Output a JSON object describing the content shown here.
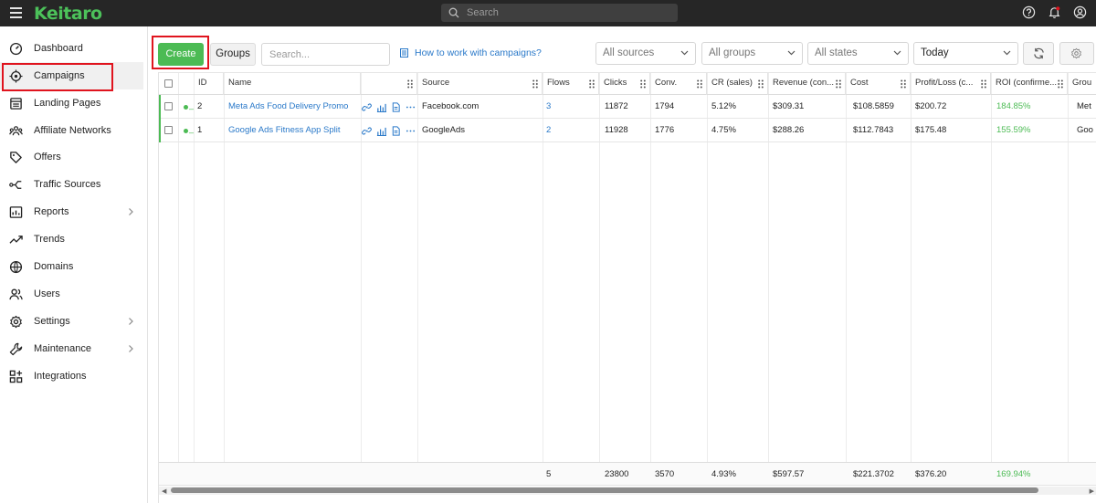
{
  "app": {
    "logo": "Keitaro"
  },
  "topbar": {
    "search_placeholder": "Search"
  },
  "sidebar": {
    "items": [
      {
        "label": "Dashboard",
        "icon": "dashboard-icon"
      },
      {
        "label": "Campaigns",
        "icon": "campaigns-icon",
        "active": true
      },
      {
        "label": "Landing Pages",
        "icon": "landing-pages-icon"
      },
      {
        "label": "Affiliate Networks",
        "icon": "affiliate-networks-icon"
      },
      {
        "label": "Offers",
        "icon": "offers-icon"
      },
      {
        "label": "Traffic Sources",
        "icon": "traffic-sources-icon"
      },
      {
        "label": "Reports",
        "icon": "reports-icon",
        "chevron": true
      },
      {
        "label": "Trends",
        "icon": "trends-icon"
      },
      {
        "label": "Domains",
        "icon": "domains-icon"
      },
      {
        "label": "Users",
        "icon": "users-icon"
      },
      {
        "label": "Settings",
        "icon": "settings-icon",
        "chevron": true
      },
      {
        "label": "Maintenance",
        "icon": "maintenance-icon",
        "chevron": true
      },
      {
        "label": "Integrations",
        "icon": "integrations-icon"
      }
    ]
  },
  "toolbar": {
    "create_label": "Create",
    "groups_label": "Groups",
    "search_placeholder": "Search...",
    "help_link": "How to work with campaigns?",
    "filters": {
      "sources": "All sources",
      "groups": "All groups",
      "states": "All states",
      "period": "Today"
    }
  },
  "table": {
    "columns": {
      "id": "ID",
      "name": "Name",
      "source": "Source",
      "flows": "Flows",
      "clicks": "Clicks",
      "conv": "Conv.",
      "cr": "CR (sales)",
      "revenue": "Revenue (con...",
      "cost": "Cost",
      "profit": "Profit/Loss (c...",
      "roi": "ROI (confirme...",
      "group": "Grou"
    },
    "rows": [
      {
        "id": "2",
        "name": "Meta Ads Food Delivery Promo",
        "source": "Facebook.com",
        "flows": "3",
        "clicks": "11872",
        "conv": "1794",
        "cr": "5.12%",
        "revenue": "$309.31",
        "cost": "$108.5859",
        "profit": "$200.72",
        "roi": "184.85%",
        "group": "Met"
      },
      {
        "id": "1",
        "name": "Google Ads Fitness App Split",
        "source": "GoogleAds",
        "flows": "2",
        "clicks": "11928",
        "conv": "1776",
        "cr": "4.75%",
        "revenue": "$288.26",
        "cost": "$112.7843",
        "profit": "$175.48",
        "roi": "155.59%",
        "group": "Goo"
      }
    ],
    "totals": {
      "flows": "5",
      "clicks": "23800",
      "conv": "3570",
      "cr": "4.93%",
      "revenue": "$597.57",
      "cost": "$221.3702",
      "profit": "$376.20",
      "roi": "169.94%"
    },
    "status_color": "#4cbb54"
  }
}
